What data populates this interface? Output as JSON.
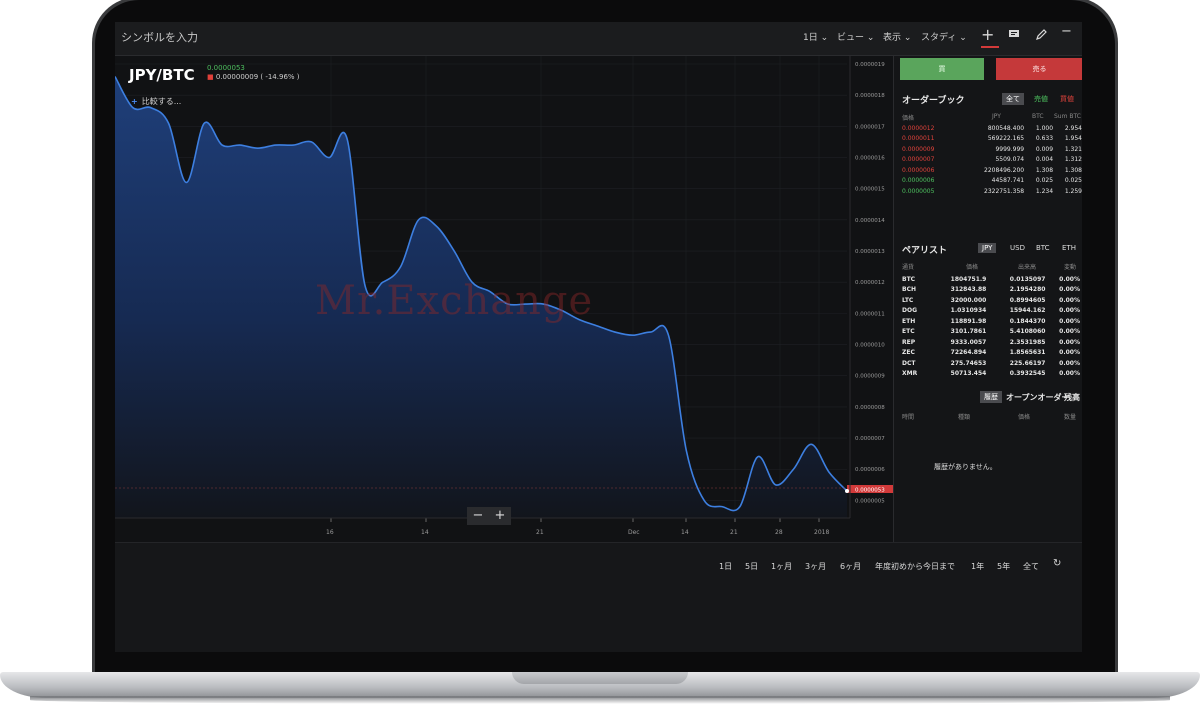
{
  "toolbar": {
    "symbol_placeholder": "シンボルを入力",
    "interval": "1日 ⌄",
    "view": "ビュー ⌄",
    "display": "表示 ⌄",
    "study": "スタディ ⌄",
    "add_icon": "plus-icon",
    "note_icon": "comment-icon",
    "draw_icon": "pencil-icon",
    "min_icon": "minus-icon"
  },
  "chart_header": {
    "pair": "JPY/BTC",
    "price": "0.0000053",
    "change": "0.00000009 ( -14.96% )",
    "compare": "比較する..."
  },
  "watermark": "Mr.Exchange",
  "zoom": {
    "minus": "−",
    "plus": "+"
  },
  "colors": {
    "buy": "#5aa55c",
    "sell": "#c5393a",
    "line": "#3d7fe0",
    "ask": "#e0433c",
    "bid": "#4dc15f"
  },
  "chart_data": {
    "type": "area",
    "x_labels": [
      "16",
      "14",
      "21",
      "Dec",
      "14",
      "21",
      "28",
      "2018"
    ],
    "y_labels": [
      "0.0000019",
      "0.0000018",
      "0.0000017",
      "0.0000016",
      "0.0000015",
      "0.0000014",
      "0.0000013",
      "0.0000012",
      "0.0000011",
      "0.0000010",
      "0.0000009",
      "0.0000008",
      "0.0000007",
      "0.0000006",
      "0.0000005"
    ],
    "ylim": [
      4.5e-07,
      1.9e-06
    ],
    "current_label": "0.0000053",
    "values": [
      1.86e-06,
      1.76e-06,
      1.76e-06,
      1.71e-06,
      1.52e-06,
      1.71e-06,
      1.64e-06,
      1.64e-06,
      1.63e-06,
      1.64e-06,
      1.64e-06,
      1.65e-06,
      1.6e-06,
      1.66e-06,
      1.19e-06,
      1.2e-06,
      1.25e-06,
      1.4e-06,
      1.38e-06,
      1.3e-06,
      1.2e-06,
      1.17e-06,
      1.13e-06,
      1.13e-06,
      1.13e-06,
      1.11e-06,
      1.08e-06,
      1.06e-06,
      1.04e-06,
      1.03e-06,
      1.04e-06,
      1.03e-06,
      6.6e-07,
      5e-07,
      4.8e-07,
      4.8e-07,
      6.4e-07,
      5.5e-07,
      6e-07,
      6.8e-07,
      5.9e-07,
      5.3e-07
    ]
  },
  "buy_label": "買",
  "sell_label": "売る",
  "orderbook": {
    "title": "オーダーブック",
    "tabs": [
      "全て",
      "売値",
      "買値"
    ],
    "headers": [
      "価格",
      "JPY",
      "BTC",
      "Sum BTC"
    ],
    "rows": [
      {
        "price": "0.0000012",
        "side": "ask",
        "jpy": "800548.400",
        "btc": "1.000",
        "sum": "2.954"
      },
      {
        "price": "0.0000011",
        "side": "ask",
        "jpy": "569222.165",
        "btc": "0.633",
        "sum": "1.954"
      },
      {
        "price": "0.0000009",
        "side": "ask",
        "jpy": "9999.999",
        "btc": "0.009",
        "sum": "1.321"
      },
      {
        "price": "0.0000007",
        "side": "ask",
        "jpy": "5509.074",
        "btc": "0.004",
        "sum": "1.312"
      },
      {
        "price": "0.0000006",
        "side": "ask",
        "jpy": "2208496.200",
        "btc": "1.308",
        "sum": "1.308"
      },
      {
        "price": "0.0000006",
        "side": "bid",
        "jpy": "44587.741",
        "btc": "0.025",
        "sum": "0.025"
      },
      {
        "price": "0.0000005",
        "side": "bid",
        "jpy": "2322751.358",
        "btc": "1.234",
        "sum": "1.259"
      }
    ]
  },
  "pairlist": {
    "title": "ペアリスト",
    "tabs": [
      "JPY",
      "USD",
      "BTC",
      "ETH"
    ],
    "headers": [
      "通貨",
      "価格",
      "出来高",
      "変動"
    ],
    "rows": [
      {
        "sym": "BTC",
        "price": "1804751.9",
        "vol": "0.0135097",
        "chg": "0.00%"
      },
      {
        "sym": "BCH",
        "price": "312843.88",
        "vol": "2.1954280",
        "chg": "0.00%"
      },
      {
        "sym": "LTC",
        "price": "32000.000",
        "vol": "0.8994605",
        "chg": "0.00%"
      },
      {
        "sym": "DOG",
        "price": "1.0310934",
        "vol": "15944.162",
        "chg": "0.00%"
      },
      {
        "sym": "ETH",
        "price": "118891.98",
        "vol": "0.1844370",
        "chg": "0.00%"
      },
      {
        "sym": "ETC",
        "price": "3101.7861",
        "vol": "5.4108060",
        "chg": "0.00%"
      },
      {
        "sym": "REP",
        "price": "9333.0057",
        "vol": "2.3531985",
        "chg": "0.00%"
      },
      {
        "sym": "ZEC",
        "price": "72264.894",
        "vol": "1.8565631",
        "chg": "0.00%"
      },
      {
        "sym": "DCT",
        "price": "275.74653",
        "vol": "225.66197",
        "chg": "0.00%"
      },
      {
        "sym": "XMR",
        "price": "50713.454",
        "vol": "0.3932545",
        "chg": "0.00%"
      }
    ]
  },
  "orders": {
    "tabs": [
      "履歴",
      "オープンオーダー",
      "残高"
    ],
    "headers": [
      "時間",
      "種類",
      "価格",
      "数量"
    ],
    "empty": "履歴がありません。"
  },
  "ranges": [
    "1日",
    "5日",
    "1ヶ月",
    "3ヶ月",
    "6ヶ月",
    "年度初めから今日まで",
    "1年",
    "5年",
    "全て",
    "↻"
  ]
}
